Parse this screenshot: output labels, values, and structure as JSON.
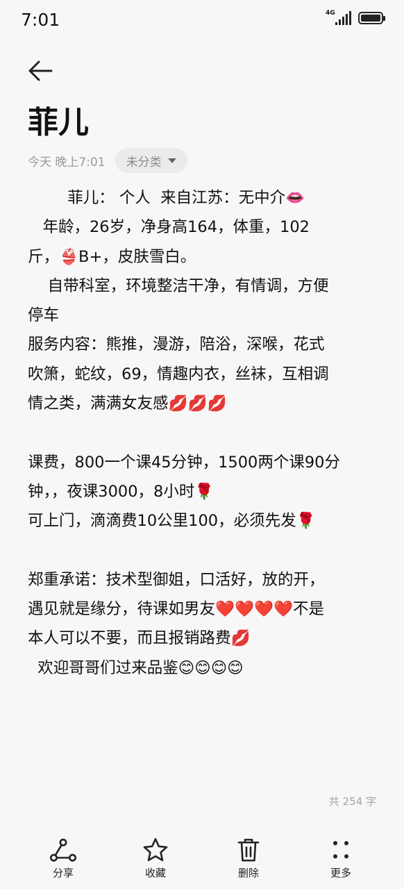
{
  "status": {
    "time": "7:01",
    "network": "4G"
  },
  "note": {
    "title": "菲儿",
    "date": "今天 晚上7:01",
    "category": "未分类",
    "lines": [
      "        菲儿： 个人  来自江苏：无中介👄",
      "   年龄，26岁，净身高164，体重，102",
      "斤，👙B+，皮肤雪白。",
      "    自带科室，环境整洁干净，有情调，方便",
      "停车",
      "服务内容：熊推，漫游，陪浴，深喉，花式",
      "吹箫，蛇纹，69，情趣内衣，丝袜，互相调",
      "情之类，满满女友感💋💋💋",
      "",
      "课费，800一个课45分钟，1500两个课90分",
      "钟，，夜课3000，8小时🌹",
      "可上门，滴滴费10公里100，必须先发🌹",
      "",
      "郑重承诺：技术型御姐，口活好，放的开，",
      "遇见就是缘分，待课如男友❤️❤️❤️❤️不是",
      "本人可以不要，而且报销路费💋",
      "  欢迎哥哥们过来品鉴😊😊😊😊"
    ],
    "word_count": "共 254 字"
  },
  "toolbar": {
    "share": "分享",
    "favorite": "收藏",
    "delete": "删除",
    "more": "更多"
  },
  "icons": {
    "back": "arrow-left-icon",
    "category": "chevron-down-icon",
    "share": "share-nodes-icon",
    "favorite": "star-outline-icon",
    "delete": "trash-icon",
    "more": "dots-grid-icon"
  }
}
